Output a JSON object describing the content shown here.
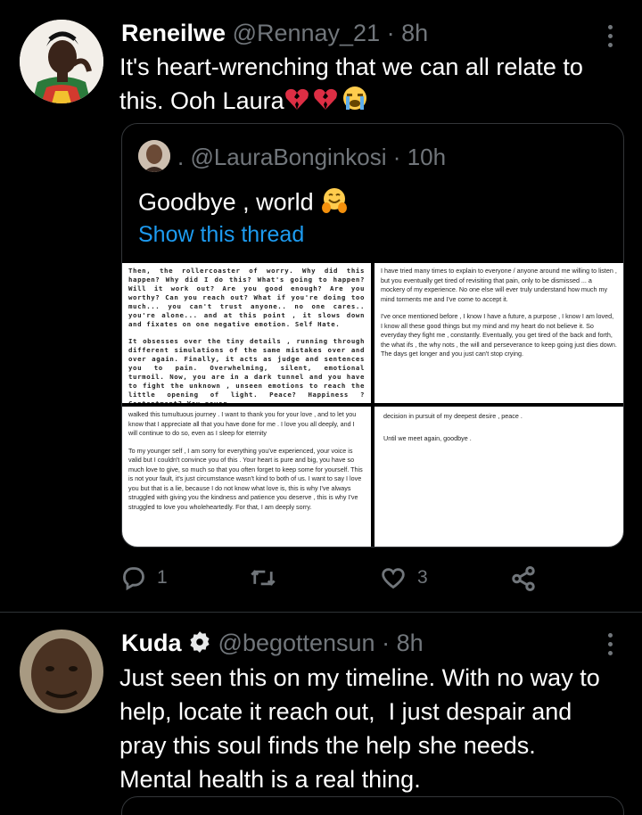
{
  "tweet1": {
    "name": "Reneilwe",
    "handle": "@Rennay_21",
    "separator": "·",
    "time": "8h",
    "text": "It's heart-wrenching that we can all relate to this. Ooh Laura",
    "emojis": [
      "broken-heart",
      "broken-heart",
      "loudly-crying-face"
    ],
    "quote": {
      "handle_line": ". @LauraBonginkosi",
      "separator": "·",
      "time": "10h",
      "text": "Goodbye , world",
      "emoji": "hugging-face",
      "link": "Show this thread",
      "images": {
        "top_left": [
          "Then, the rollercoaster of worry. Why did this happen? Why did I do this? What's going to happen? Will it work out? Are you good enough? Are you worthy? Can you reach out? What if you're doing too much... you can't trust anyone.. no one cares.. you're alone... and at this point , it slows down and fixates on one negative emotion. Self Hate.",
          "It obsesses over the tiny details , running through different simulations of the same mistakes over and over again. Finally, it acts as judge and sentences you to pain. Overwhelming, silent, emotional turmoil. Now, you are in a dark tunnel and you have to fight the unknown , unseen emotions to reach the little opening of light. Peace? Happiness ? Contentment? You never"
        ],
        "top_right": [
          "I have tried many times to explain to everyone / anyone around me willing to listen , but you eventually get tired of revisiting that pain, only to be dismissed ... a mockery of my experience. No one else will ever truly understand how much my mind torments me and I've come to accept it.",
          "I've once mentioned before , I know I have a future, a purpose , I know I am loved, I know all these good things but my mind and my heart do not believe it. So everyday they fight me , constantly. Eventually, you get tired of the back and forth, the what ifs , the why nots , the will and perseverance to keep going just dies down. The days get longer and you just can't stop crying."
        ],
        "bottom_left": [
          "walked this tumultuous journey . I want to thank you for your love , and to let you know that I appreciate all that you have done for me . I love you all deeply, and I will continue to do so, even as I sleep for eternity",
          "To my younger self , I am sorry for everything you've experienced, your voice is valid but I couldn't convince you of this . Your heart is pure and big, you have so much love to give, so much so that you often forget to keep some for yourself. This is not your fault, it's just circumstance wasn't kind to both of us. I want to say I love you but that is a lie, because I do not know what love is, this is why I've always struggled with giving you the kindness and patience you deserve , this is why I've struggled to love you wholeheartedly. For that, I am deeply sorry."
        ],
        "bottom_right": [
          "decision in pursuit of my deepest desire , peace .",
          "Until we meet again, goodbye ."
        ]
      }
    },
    "actions": {
      "reply_count": "1",
      "retweet_count": "",
      "like_count": "3"
    }
  },
  "tweet2": {
    "name": "Kuda",
    "handle": "@begottensun",
    "separator": "·",
    "time": "8h",
    "text_lines": [
      "Just seen this on my timeline. With no way to",
      "help, locate it reach out,  I just despair and",
      "pray this soul finds the help she needs.",
      "Mental health is a real thing."
    ]
  },
  "colors": {
    "background": "#000000",
    "text": "#ffffff",
    "muted": "#71767b",
    "link": "#1d9bf0",
    "border": "#333639",
    "heart_red": "#e0245e"
  }
}
